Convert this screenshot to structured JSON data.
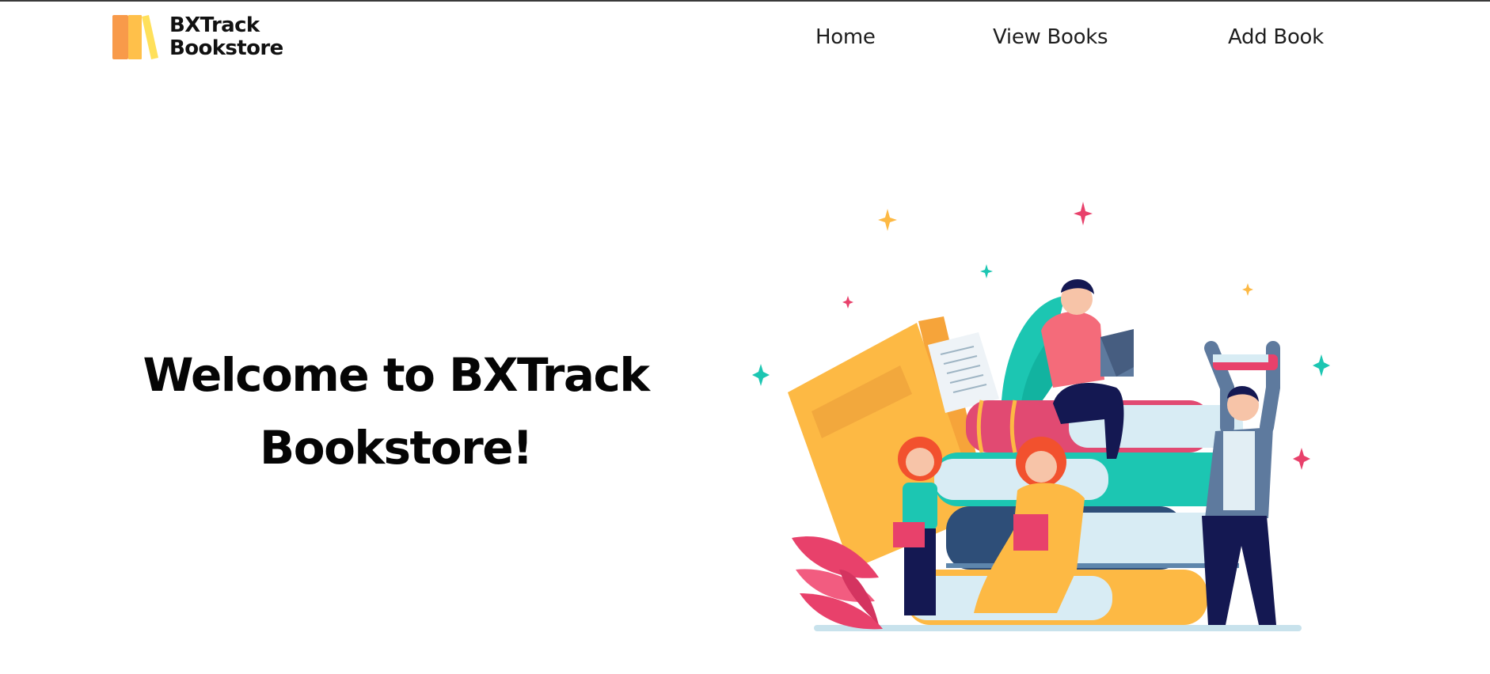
{
  "brand": {
    "name_line1": "BXTrack",
    "name_line2": "Bookstore",
    "logo_icon": "books-logo-icon"
  },
  "nav": {
    "items": [
      {
        "label": "Home"
      },
      {
        "label": "View Books"
      },
      {
        "label": "Add Book"
      }
    ]
  },
  "hero": {
    "title_line1": "Welcome to BXTrack",
    "title_line2": "Bookstore!",
    "illustration": "people-reading-books-illustration"
  },
  "colors": {
    "orange": "#F89A4A",
    "yellow": "#FFD35A",
    "book_yellow": "#FDB944",
    "pink": "#E8416B",
    "teal": "#1CC6B2",
    "navy": "#141852",
    "light_blue": "#D8ECF4"
  }
}
